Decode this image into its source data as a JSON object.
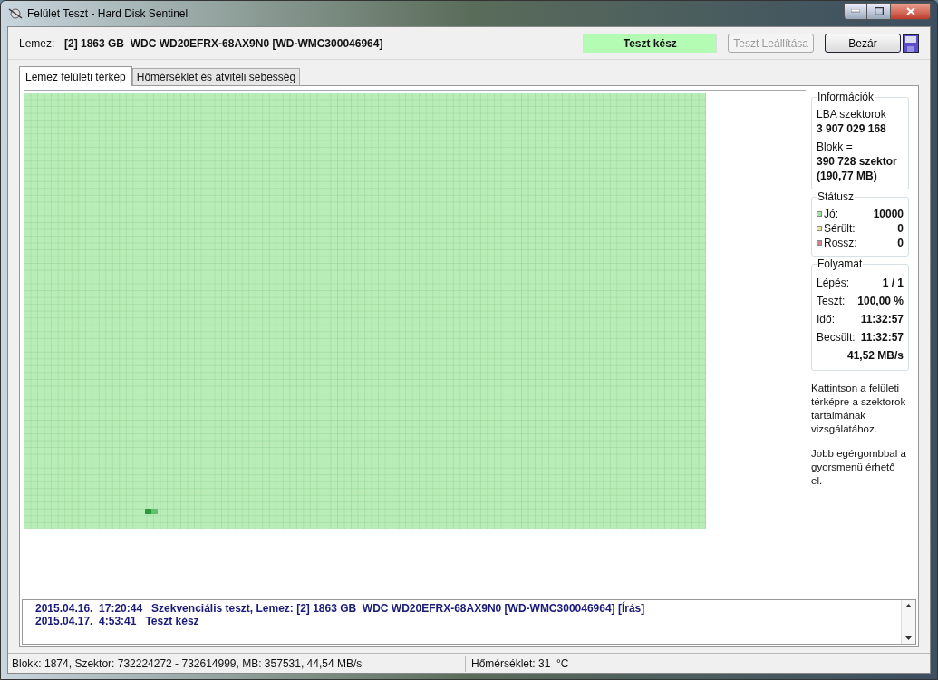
{
  "window": {
    "title": "Felület Teszt - Hard Disk Sentinel"
  },
  "header": {
    "disk_label": "Lemez:",
    "disk_value": "[2] 1863 GB  WDC WD20EFRX-68AX9N0 [WD-WMC300046964]",
    "status": "Teszt kész",
    "buttons": [
      {
        "label": "Teszt Leállítása",
        "disabled": true
      },
      {
        "label": "Bezár",
        "disabled": false
      }
    ]
  },
  "tabs": [
    {
      "label": "Lemez felületi térkép",
      "selected": true
    },
    {
      "label": "Hőmérséklet és átviteli sebesség",
      "selected": false
    }
  ],
  "info": {
    "title": "Információk",
    "lba_label": "LBA szektorok",
    "lba_value": "3 907 029 168",
    "block_label": "Blokk =",
    "block_value": "390 728 szektor",
    "block_size": "(190,77 MB)"
  },
  "status_box": {
    "title": "Státusz",
    "items": [
      {
        "label": "Jó:",
        "value": "10000",
        "color": "#a8e0a8"
      },
      {
        "label": "Sérült:",
        "value": "0",
        "color": "#e8e8a0"
      },
      {
        "label": "Rossz:",
        "value": "0",
        "color": "#d08890"
      }
    ]
  },
  "progress": {
    "title": "Folyamat",
    "rows": [
      {
        "label": "Lépés:",
        "value": "1 / 1"
      },
      {
        "label": "Teszt:",
        "value": "100,00 %"
      },
      {
        "label": "Idő:",
        "value": "11:32:57"
      },
      {
        "label": "Becsült:",
        "value": "11:32:57"
      }
    ],
    "speed": "41,52 MB/s"
  },
  "hints": [
    "Kattintson a felületi térképre a szektorok tartalmának vizsgálatához.",
    "Jobb egérgombbal a gyorsmenü érhető el."
  ],
  "log": [
    "2015.04.16.  17:20:44   Szekvenciális teszt, Lemez: [2] 1863 GB  WDC WD20EFRX-68AX9N0 [WD-WMC300046964] [Írás]",
    "2015.04.17.  4:53:41   Teszt kész"
  ],
  "status_bar": [
    "Blokk: 1874, Szektor: 732224272 - 732614999, MB: 357531, 44,54 MB/s",
    "Hőmérséklet: 31  °C"
  ]
}
